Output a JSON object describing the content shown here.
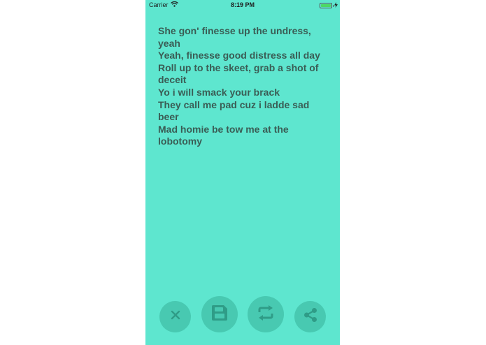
{
  "status_bar": {
    "carrier": "Carrier",
    "time": "8:19 PM",
    "battery_level": 1.0
  },
  "lyrics": {
    "lines": [
      "She gon' finesse up the undress, yeah",
      "Yeah, finesse good distress all day",
      "Roll up to the skeet, grab a shot of deceit",
      "Yo i will smack your brack",
      "They call me pad cuz i ladde sad beer",
      "Mad homie be tow me at the lobotomy"
    ]
  },
  "actions": {
    "close_icon": "close-icon",
    "save_icon": "floppy-disk-icon",
    "repeat_icon": "repeat-icon",
    "share_icon": "share-icon"
  },
  "colors": {
    "background": "#5ee6cf",
    "button": "#48c9b1",
    "icon": "#2f9c87",
    "text": "#3a5d55"
  }
}
